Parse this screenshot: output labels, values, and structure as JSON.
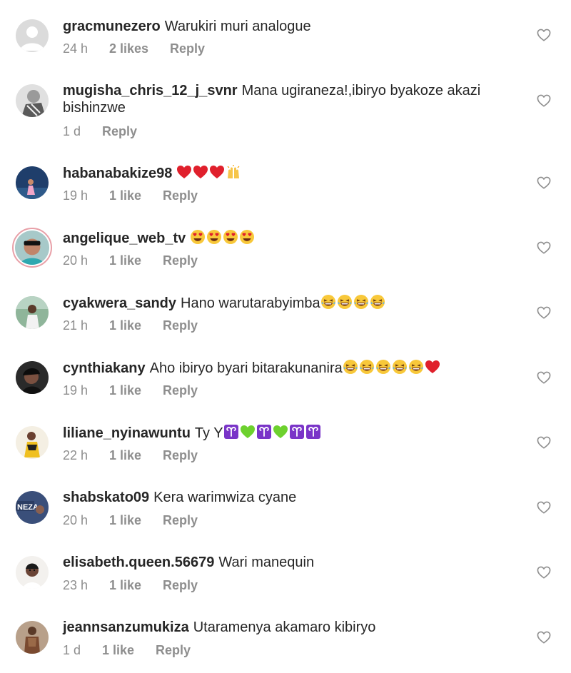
{
  "comments": [
    {
      "username": "gracmunezero",
      "text": "Warukiri muri analogue",
      "time": "24 h",
      "likes": "2 likes",
      "reply": "Reply",
      "avatar": "default-avatar",
      "emojis": []
    },
    {
      "username": "mugisha_chris_12_j_svnr",
      "text": "Mana ugiraneza!,ibiryo byakoze akazi bishinzwe",
      "time": "1 d",
      "likes": "",
      "reply": "Reply",
      "avatar": "photo-avatar-grayscale",
      "emojis": []
    },
    {
      "username": "habanabakize98",
      "text": "",
      "time": "19 h",
      "likes": "1 like",
      "reply": "Reply",
      "avatar": "photo-avatar-blue",
      "emojis": [
        "heart",
        "heart",
        "heart",
        "raised-hands"
      ]
    },
    {
      "username": "angelique_web_tv",
      "text": "",
      "time": "20 h",
      "likes": "1 like",
      "reply": "Reply",
      "avatar": "photo-avatar-story",
      "emojis": [
        "heart-eyes",
        "heart-eyes",
        "heart-eyes",
        "heart-eyes"
      ]
    },
    {
      "username": "cyakwera_sandy",
      "text": "Hano  warutarabyimba",
      "time": "21 h",
      "likes": "1 like",
      "reply": "Reply",
      "avatar": "photo-avatar-green",
      "emojis": [
        "laughing",
        "laughing",
        "laughing",
        "laughing"
      ]
    },
    {
      "username": "cynthiakany",
      "text": "Aho ibiryo byari bitarakunanira",
      "time": "19 h",
      "likes": "1 like",
      "reply": "Reply",
      "avatar": "photo-avatar-dark",
      "emojis": [
        "laughing",
        "laughing",
        "laughing",
        "laughing",
        "laughing",
        "heart"
      ]
    },
    {
      "username": "liliane_nyinawuntu",
      "text": "Ty Y",
      "time": "22 h",
      "likes": "1 like",
      "reply": "Reply",
      "avatar": "photo-avatar-yellow",
      "emojis": [
        "aries",
        "green-heart",
        "aries",
        "green-heart",
        "aries",
        "aries"
      ]
    },
    {
      "username": "shabskato09",
      "text": "Kera warimwiza cyane",
      "time": "20 h",
      "likes": "1 like",
      "reply": "Reply",
      "avatar": "photo-avatar-navy",
      "emojis": []
    },
    {
      "username": "elisabeth.queen.56679",
      "text": "Wari manequin",
      "time": "23 h",
      "likes": "1 like",
      "reply": "Reply",
      "avatar": "photo-avatar-light",
      "emojis": []
    },
    {
      "username": "jeannsanzumukiza",
      "text": "Utaramenya akamaro kibiryo",
      "time": "1 d",
      "likes": "1 like",
      "reply": "Reply",
      "avatar": "photo-avatar-brown",
      "emojis": []
    }
  ],
  "icons": {
    "like": "heart-outline-icon"
  },
  "colors": {
    "text": "#262626",
    "meta": "#8e8e8e",
    "heart_icon": "#8e8e8e"
  }
}
